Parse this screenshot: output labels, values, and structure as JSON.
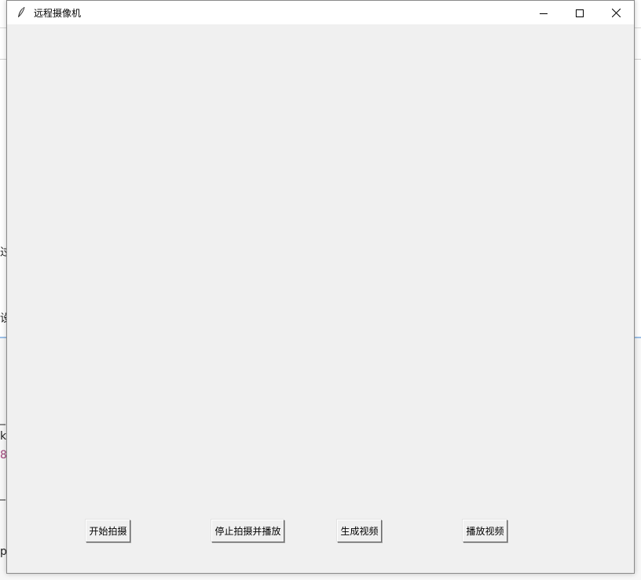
{
  "window": {
    "title": "远程摄像机",
    "controls": {
      "minimize": "minimize-icon",
      "maximize": "maximize-icon",
      "close": "close-icon"
    }
  },
  "buttons": {
    "start_capture": "开始拍摄",
    "stop_and_play": "停止拍摄并播放",
    "generate_video": "生成视频",
    "play_video": "播放视频"
  },
  "background_fragments": {
    "f1": "过",
    "f2": "设",
    "f3": "_",
    "f4": "k",
    "f5": "8",
    "f6": "_",
    "f7": "p"
  },
  "colors": {
    "window_bg": "#f0f0f0",
    "titlebar_bg": "#ffffff",
    "accent_line": "#9cc0e8"
  }
}
